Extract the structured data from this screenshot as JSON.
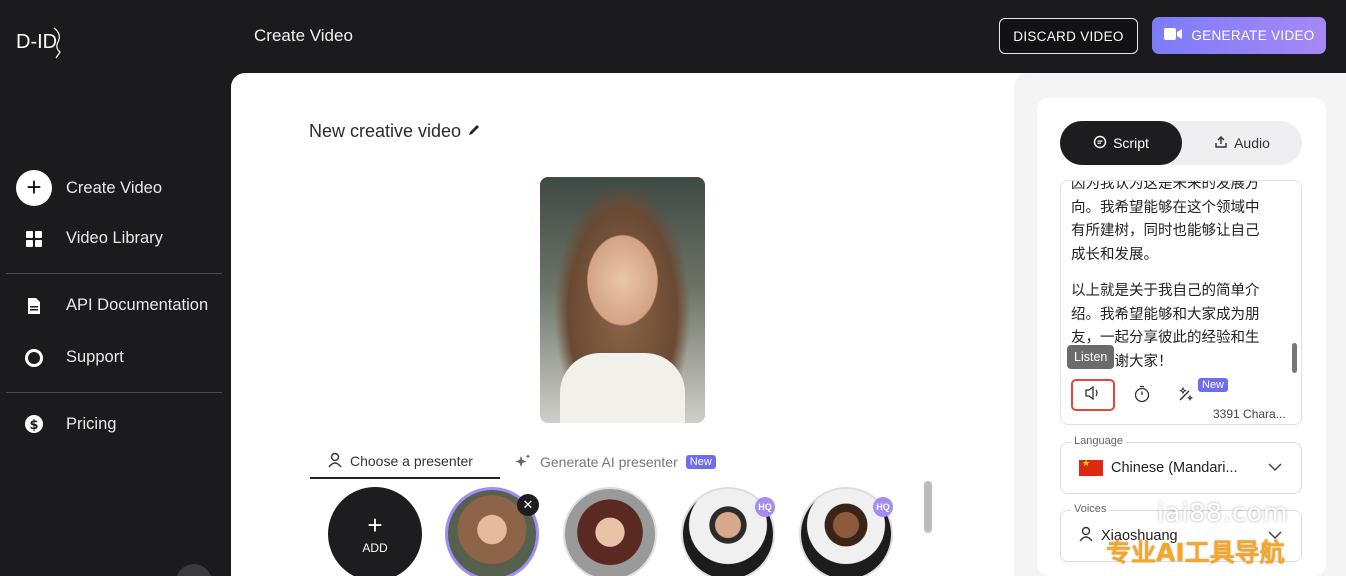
{
  "header": {
    "logo_text": "D-ID",
    "title": "Create Video",
    "discard_label": "DISCARD VIDEO",
    "generate_label": "GENERATE VIDEO",
    "accent": "#8b83f6"
  },
  "sidebar": {
    "items": [
      {
        "label": "Create Video",
        "icon": "plus-circle-icon"
      },
      {
        "label": "Video Library",
        "icon": "grid-icon"
      },
      {
        "label": "API Documentation",
        "icon": "document-icon"
      },
      {
        "label": "Support",
        "icon": "lifebuoy-icon"
      },
      {
        "label": "Pricing",
        "icon": "dollar-coin-icon"
      }
    ]
  },
  "main": {
    "video_name": "New creative video",
    "tabs": [
      {
        "label": "Choose a presenter",
        "icon": "person-icon"
      },
      {
        "label": "Generate AI presenter",
        "icon": "sparkle-icon",
        "badge": "New"
      }
    ],
    "add_label": "ADD",
    "add_plus": "+",
    "remove_glyph": "✕",
    "hq_badge": "HQ"
  },
  "right_panel": {
    "tabs": [
      {
        "label": "Script",
        "icon": "chat-bubble-icon",
        "active": true
      },
      {
        "label": "Audio",
        "icon": "upload-icon",
        "active": false
      }
    ],
    "script_paragraphs": [
      "因为我认为这是未来的发展方向。我希望能够在这个领域中有所建树，同时也能够让自己成长和发展。",
      "以上就是关于我自己的简单介绍。我希望能够和大家成为朋友，一起分享彼此的经验和生活。谢谢大家！"
    ],
    "listen_tooltip": "Listen",
    "new_badge": "New",
    "char_count": "3391 Chara...",
    "language_label": "Language",
    "language_value": "Chinese (Mandari...",
    "voices_label": "Voices",
    "voices_value": "Xiaoshuang",
    "highlight_color": "#e14a3b"
  },
  "watermark": {
    "line1": "iai88.com",
    "line2": "专业AI工具导航"
  }
}
